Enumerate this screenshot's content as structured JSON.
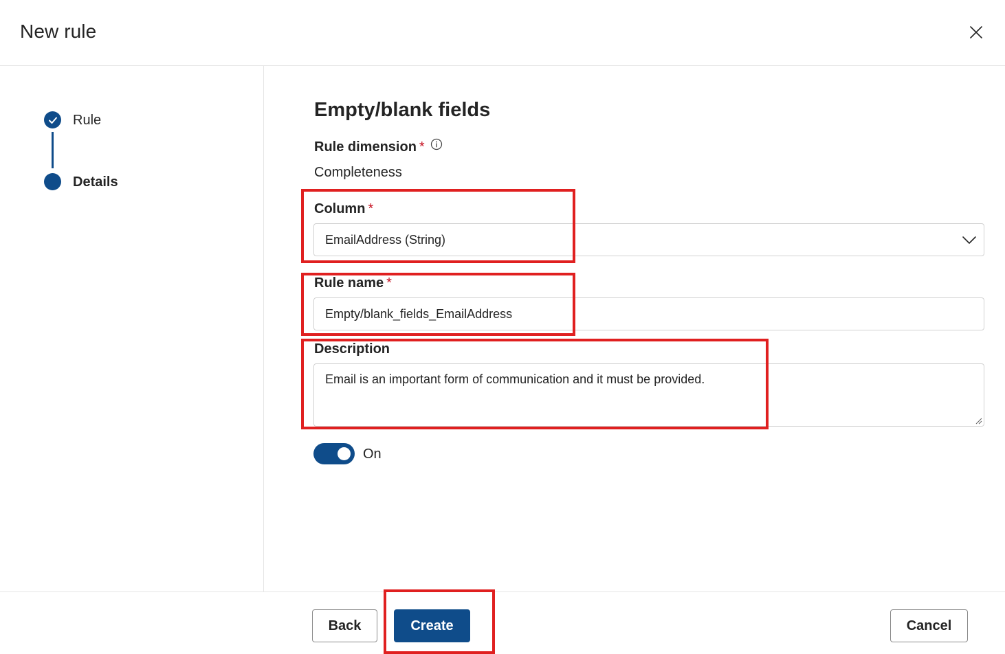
{
  "dialog": {
    "title": "New rule",
    "close_icon": "close-icon"
  },
  "stepper": {
    "steps": [
      {
        "label": "Rule",
        "state": "completed",
        "icon": "checkmark-icon"
      },
      {
        "label": "Details",
        "state": "current"
      }
    ]
  },
  "form": {
    "section_title": "Empty/blank fields",
    "rule_dimension": {
      "label": "Rule dimension",
      "required_mark": "*",
      "info_icon": "info-icon",
      "value": "Completeness"
    },
    "column": {
      "label": "Column",
      "required_mark": "*",
      "value": "EmailAddress (String)",
      "chevron_icon": "chevron-down-icon"
    },
    "rule_name": {
      "label": "Rule name",
      "required_mark": "*",
      "value": "Empty/blank_fields_EmailAddress"
    },
    "description": {
      "label": "Description",
      "value": "Email is an important form of communication and it must be provided."
    },
    "toggle": {
      "state": "on",
      "label": "On"
    }
  },
  "footer": {
    "back_label": "Back",
    "create_label": "Create",
    "cancel_label": "Cancel"
  },
  "colors": {
    "accent": "#0f4c8a",
    "required": "#c50f1f",
    "highlight": "#e02020"
  }
}
